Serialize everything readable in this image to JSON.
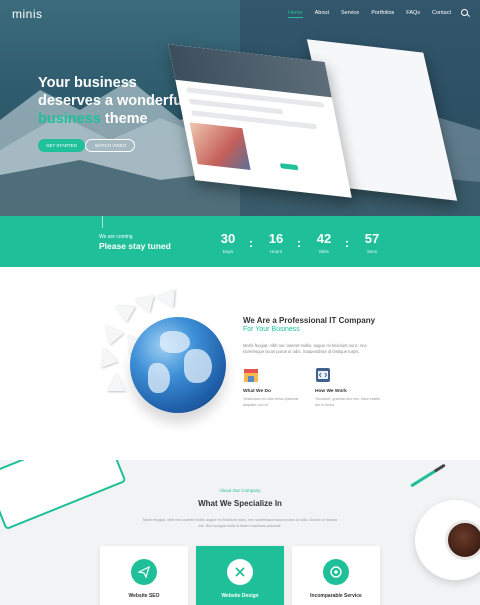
{
  "header": {
    "logo": "minis",
    "nav": [
      "Home",
      "About",
      "Service",
      "Portfolios",
      "FAQs",
      "Contact"
    ],
    "active_nav": "Home",
    "search_icon": "search-icon"
  },
  "hero": {
    "title_line1": "Your business",
    "title_line2": "deserves a wonderful",
    "title_accent": "business",
    "title_end": " theme",
    "btn_start": "GET STARTED",
    "btn_video": "WATCH VIDEO"
  },
  "countdown": {
    "small": "We are coming",
    "big": "Please stay tuned",
    "units": [
      {
        "num": "30",
        "label": "Days"
      },
      {
        "num": "16",
        "label": "Hours"
      },
      {
        "num": "42",
        "label": "Mins"
      },
      {
        "num": "57",
        "label": "Secs"
      }
    ]
  },
  "about": {
    "title": "We Are a Professional IT Company",
    "subtitle": "For Your Business",
    "text": "Morbi feugiat, nibh nec laoreet mollis, augue mi tincidunt nunc, nec scelerisque lacus purus ut odio. Suspendisse id tristique turpis.",
    "features": [
      {
        "icon": "store-icon",
        "title": "What We Do",
        "text": "Vestibulum id odio tellus placerat, aliquam orci et."
      },
      {
        "icon": "code-icon",
        "title": "How We Work",
        "text": "Tincidunt, gravida nisl nec. Nam mattis dui in tortor."
      }
    ]
  },
  "services": {
    "kicker": "About Our Company",
    "title": "What We Specialize In",
    "text": "Morbi feugiat, nibh nec laoreet mollis augue mi tincidunt nunc, nec scelerisque lacus purus ut odio. Donec ut massa est. Sed congue nulla id lorem maximus placerat.",
    "cards": [
      {
        "icon": "send-icon",
        "title": "Website SEO"
      },
      {
        "icon": "tools-icon",
        "title": "Website Design"
      },
      {
        "icon": "gear-icon",
        "title": "Incomparable Service"
      }
    ]
  },
  "colors": {
    "accent": "#1fbf99",
    "hero": "#2e5b6d"
  }
}
